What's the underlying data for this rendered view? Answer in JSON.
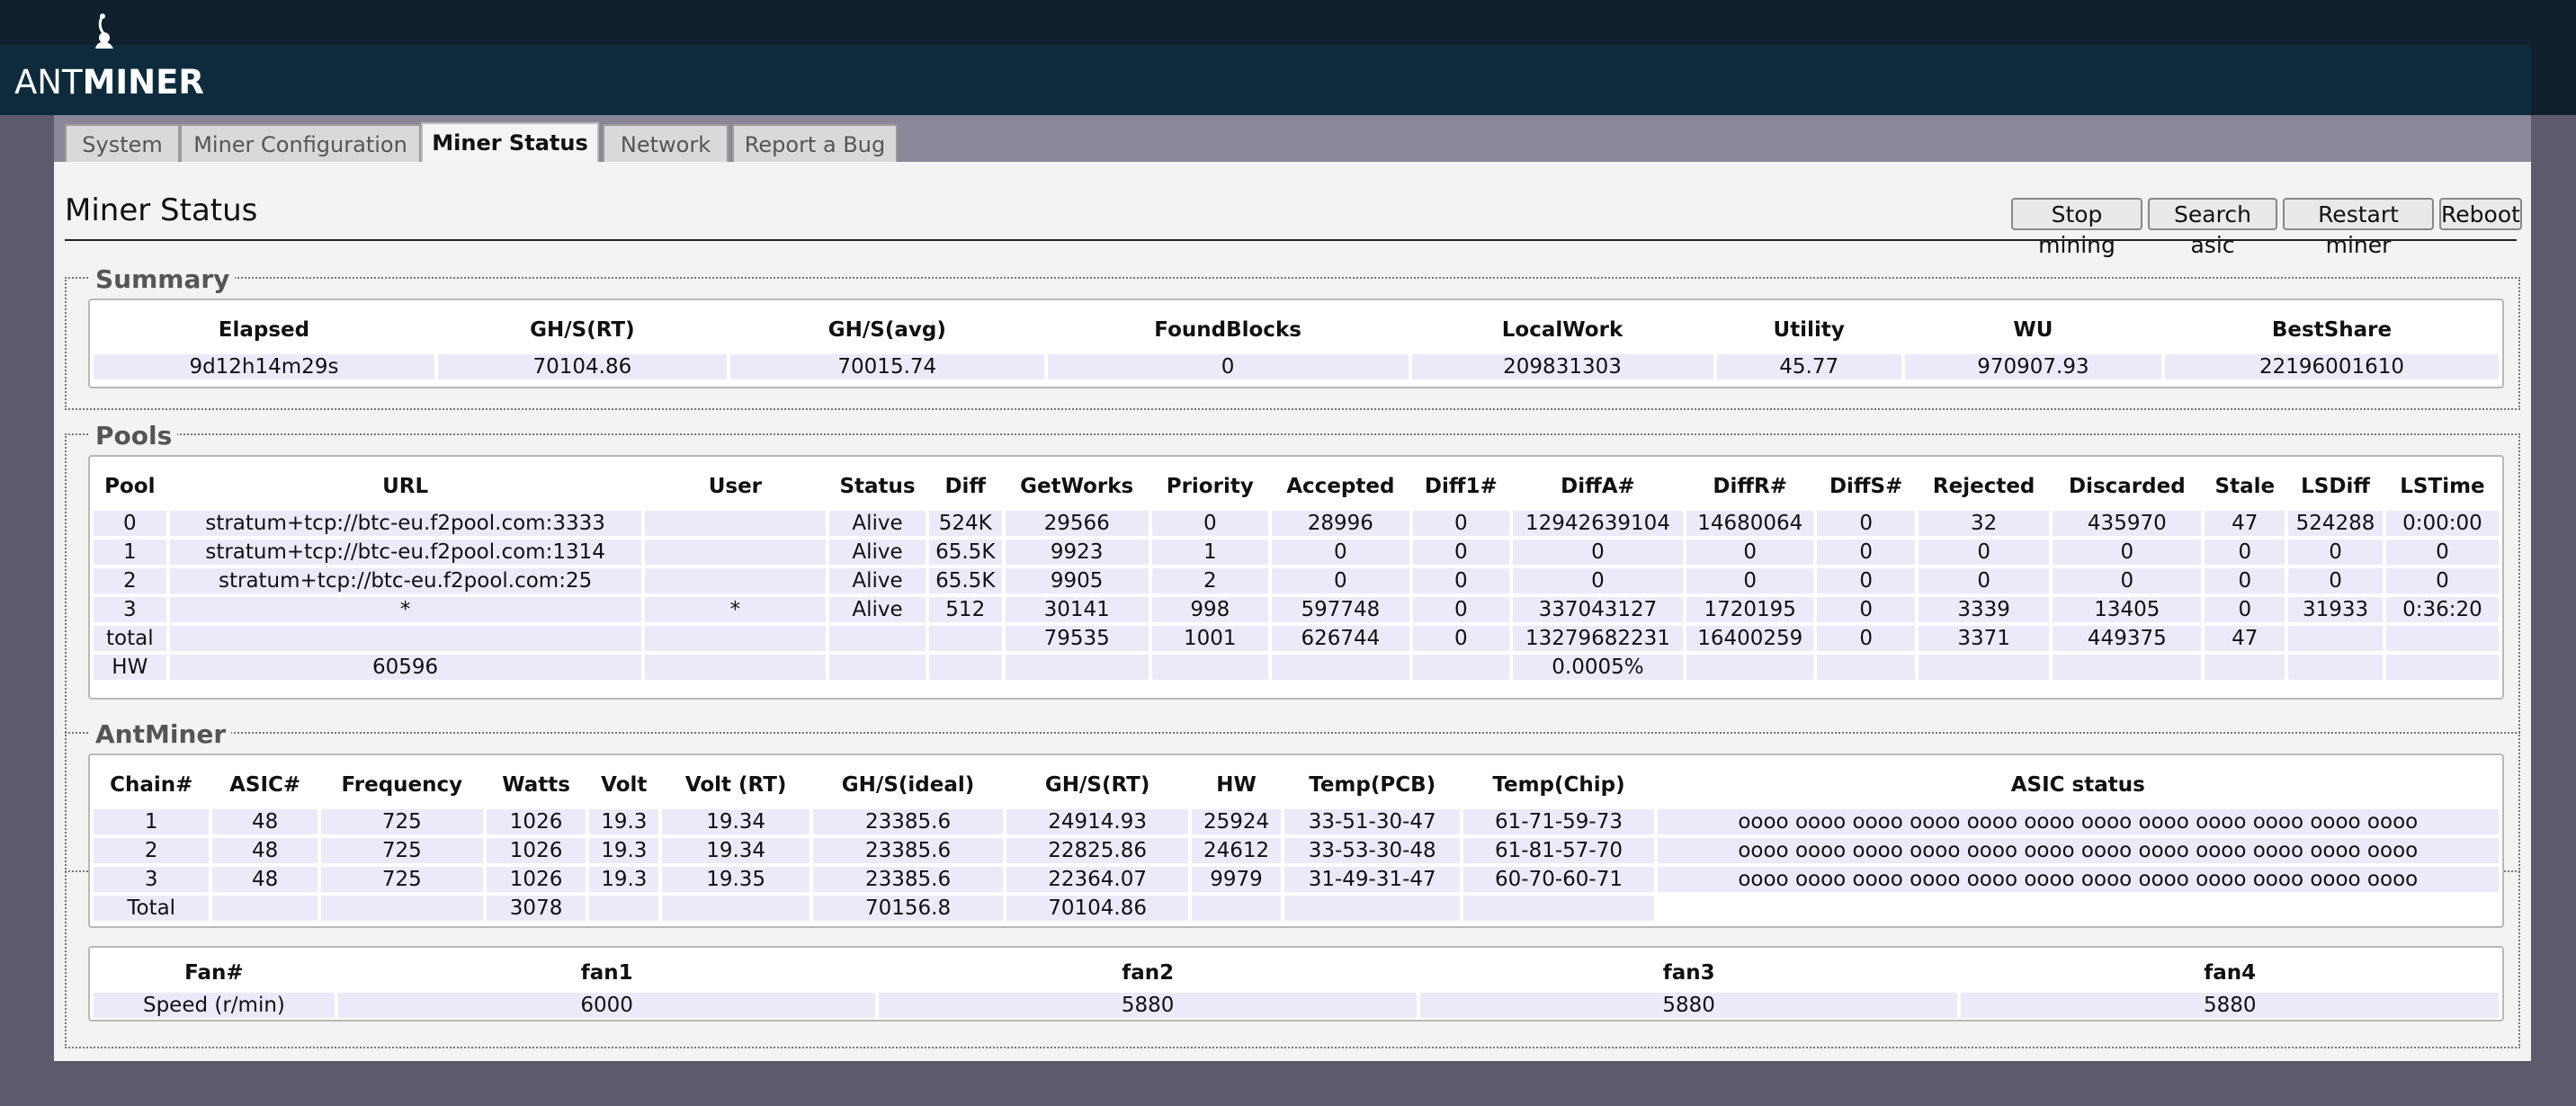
{
  "logo": {
    "prefix": "ANT",
    "suffix": "MINER"
  },
  "tabs": [
    {
      "label": "System"
    },
    {
      "label": "Miner Configuration"
    },
    {
      "label": "Miner Status"
    },
    {
      "label": "Network"
    },
    {
      "label": "Report a Bug"
    }
  ],
  "active_tab": "Miner Status",
  "page": {
    "title": "Miner Status"
  },
  "actions": {
    "stop": "Stop mining",
    "search": "Search asic",
    "restart": "Restart miner",
    "reboot": "Reboot"
  },
  "summary": {
    "legend": "Summary",
    "headers": [
      "Elapsed",
      "GH/S(RT)",
      "GH/S(avg)",
      "FoundBlocks",
      "LocalWork",
      "Utility",
      "WU",
      "BestShare"
    ],
    "values": [
      "9d12h14m29s",
      "70104.86",
      "70015.74",
      "0",
      "209831303",
      "45.77",
      "970907.93",
      "22196001610"
    ]
  },
  "pools": {
    "legend": "Pools",
    "headers": [
      "Pool",
      "URL",
      "User",
      "Status",
      "Diff",
      "GetWorks",
      "Priority",
      "Accepted",
      "Diff1#",
      "DiffA#",
      "DiffR#",
      "DiffS#",
      "Rejected",
      "Discarded",
      "Stale",
      "LSDiff",
      "LSTime"
    ],
    "rows": [
      [
        "0",
        "stratum+tcp://btc-eu.f2pool.com:3333",
        "",
        "Alive",
        "524K",
        "29566",
        "0",
        "28996",
        "0",
        "12942639104",
        "14680064",
        "0",
        "32",
        "435970",
        "47",
        "524288",
        "0:00:00"
      ],
      [
        "1",
        "stratum+tcp://btc-eu.f2pool.com:1314",
        "",
        "Alive",
        "65.5K",
        "9923",
        "1",
        "0",
        "0",
        "0",
        "0",
        "0",
        "0",
        "0",
        "0",
        "0",
        "0"
      ],
      [
        "2",
        "stratum+tcp://btc-eu.f2pool.com:25",
        "",
        "Alive",
        "65.5K",
        "9905",
        "2",
        "0",
        "0",
        "0",
        "0",
        "0",
        "0",
        "0",
        "0",
        "0",
        "0"
      ],
      [
        "3",
        "*",
        "*",
        "Alive",
        "512",
        "30141",
        "998",
        "597748",
        "0",
        "337043127",
        "1720195",
        "0",
        "3339",
        "13405",
        "0",
        "31933",
        "0:36:20"
      ],
      [
        "total",
        "",
        "",
        "",
        "",
        "79535",
        "1001",
        "626744",
        "0",
        "13279682231",
        "16400259",
        "0",
        "3371",
        "449375",
        "47",
        "",
        ""
      ],
      [
        "HW",
        "60596",
        "",
        "",
        "",
        "",
        "",
        "",
        "",
        "0.0005%",
        "",
        "",
        "",
        "",
        "",
        "",
        ""
      ]
    ]
  },
  "antminer": {
    "legend": "AntMiner",
    "headers": [
      "Chain#",
      "ASIC#",
      "Frequency",
      "Watts",
      "Volt",
      "Volt (RT)",
      "GH/S(ideal)",
      "GH/S(RT)",
      "HW",
      "Temp(PCB)",
      "Temp(Chip)",
      "ASIC status"
    ],
    "rows": [
      [
        "1",
        "48",
        "725",
        "1026",
        "19.3",
        "19.34",
        "23385.6",
        "24914.93",
        "25924",
        "33-51-30-47",
        "61-71-59-73",
        "oooo oooo oooo oooo oooo oooo oooo oooo oooo oooo oooo oooo"
      ],
      [
        "2",
        "48",
        "725",
        "1026",
        "19.3",
        "19.34",
        "23385.6",
        "22825.86",
        "24612",
        "33-53-30-48",
        "61-81-57-70",
        "oooo oooo oooo oooo oooo oooo oooo oooo oooo oooo oooo oooo"
      ],
      [
        "3",
        "48",
        "725",
        "1026",
        "19.3",
        "19.35",
        "23385.6",
        "22364.07",
        "9979",
        "31-49-31-47",
        "60-70-60-71",
        "oooo oooo oooo oooo oooo oooo oooo oooo oooo oooo oooo oooo"
      ]
    ],
    "total": {
      "label": "Total",
      "watts": "3078",
      "ideal": "70156.8",
      "rt": "70104.86"
    }
  },
  "fans": {
    "headers": [
      "Fan#",
      "fan1",
      "fan2",
      "fan3",
      "fan4"
    ],
    "row_label": "Speed (r/min)",
    "values": [
      "6000",
      "5880",
      "5880",
      "5880"
    ]
  }
}
